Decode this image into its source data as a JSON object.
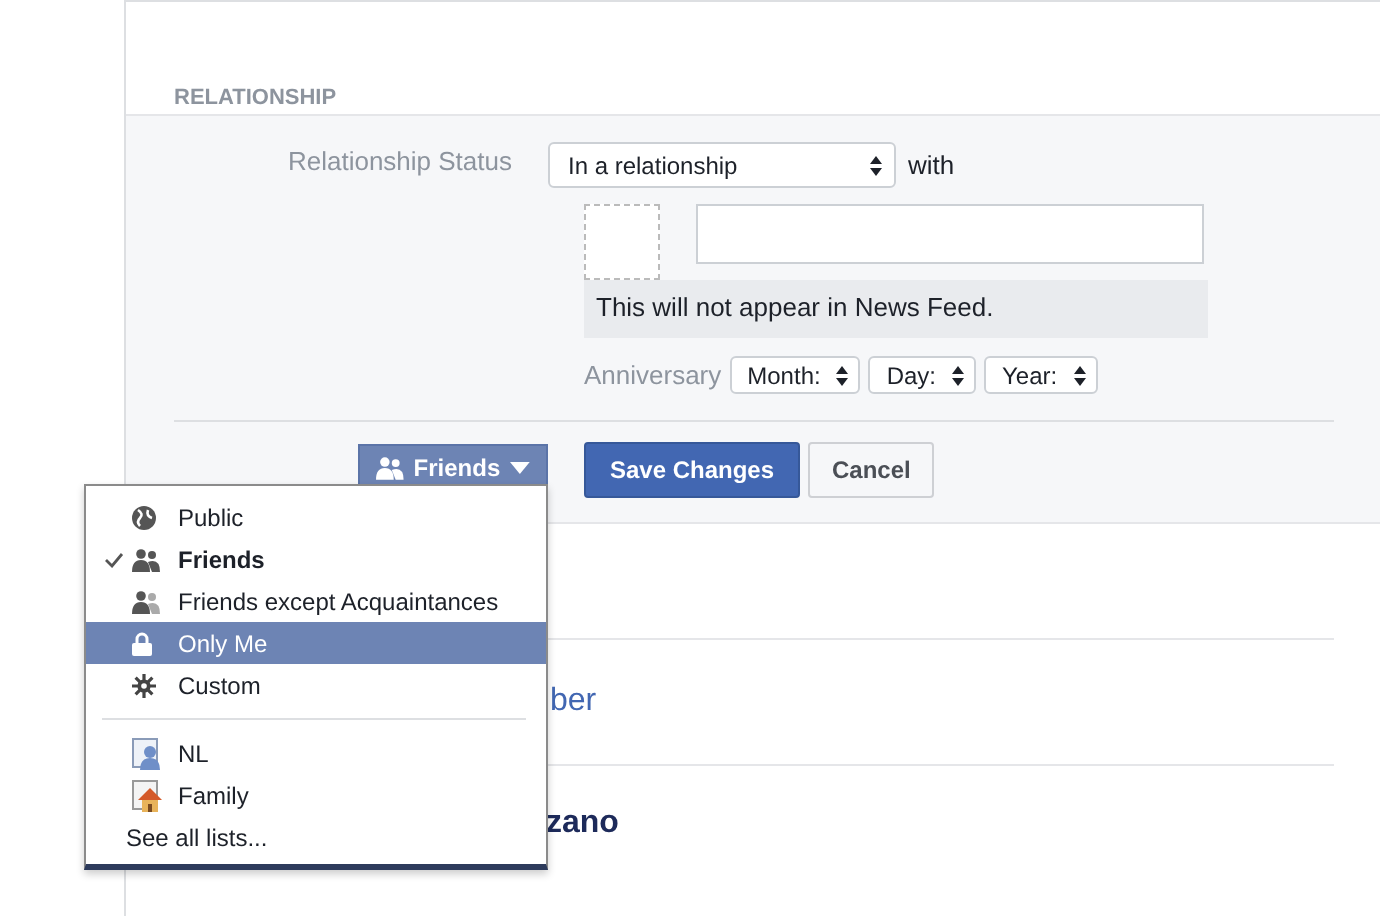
{
  "section": {
    "title": "RELATIONSHIP"
  },
  "form": {
    "status_label": "Relationship Status",
    "status_value": "In a relationship",
    "with_label": "with",
    "note": "This will not appear in News Feed.",
    "anniversary_label": "Anniversary",
    "date_selects": [
      "Month:",
      "Day:",
      "Year:"
    ]
  },
  "privacy_button": {
    "label": "Friends"
  },
  "buttons": [
    {
      "label": "Save Changes",
      "kind": "primary"
    },
    {
      "label": "Cancel",
      "kind": "secondary"
    }
  ],
  "below": [
    {
      "text": "ber",
      "kind": "link"
    },
    {
      "text": "zano",
      "kind": "name"
    }
  ],
  "privacy_menu": {
    "groups": [
      [
        {
          "label": "Public",
          "selected": false,
          "highlighted": false
        },
        {
          "label": "Friends",
          "selected": true,
          "highlighted": false
        },
        {
          "label": "Friends except Acquaintances",
          "selected": false,
          "highlighted": false
        },
        {
          "label": "Only Me",
          "selected": false,
          "highlighted": true
        },
        {
          "label": "Custom",
          "selected": false,
          "highlighted": false
        }
      ],
      [
        {
          "label": "NL",
          "selected": false,
          "highlighted": false
        },
        {
          "label": "Family",
          "selected": false,
          "highlighted": false
        },
        {
          "label": "See all lists...",
          "selected": false,
          "highlighted": false
        }
      ]
    ]
  }
}
